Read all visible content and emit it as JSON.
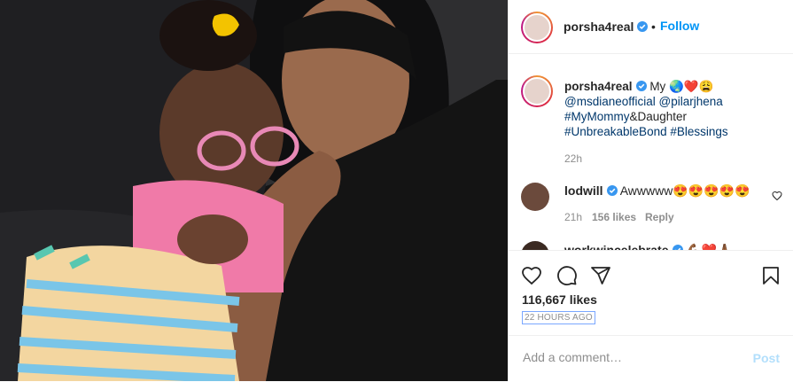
{
  "post": {
    "author": "porsha4real",
    "follow_label": "Follow",
    "dot": "•"
  },
  "caption": {
    "author": "porsha4real",
    "my": "My",
    "emojis": "🌏❤️😩",
    "mention1": "@msdianeofficial",
    "mention2": "@pilarjhena",
    "tag1": "#MyMommy",
    "tag1_rest": "&Daughter",
    "tag2": "#UnbreakableBond",
    "tag3": "#Blessings",
    "time": "22h"
  },
  "comments": [
    {
      "user": "lodwill",
      "text": "Awwwww😍😍😍😍😍",
      "time": "21h",
      "likes": "156 likes",
      "reply": "Reply"
    },
    {
      "user": "workwincelebrate",
      "text": "💪🏾❤️🙏🏾"
    }
  ],
  "actions": {
    "likes": "116,667 likes",
    "ago": "22 HOURS AGO"
  },
  "add_comment": {
    "placeholder": "Add a comment…",
    "post_label": "Post"
  },
  "colors": {
    "link": "#00376b",
    "follow": "#0095f6",
    "verified": "#3897f0"
  }
}
